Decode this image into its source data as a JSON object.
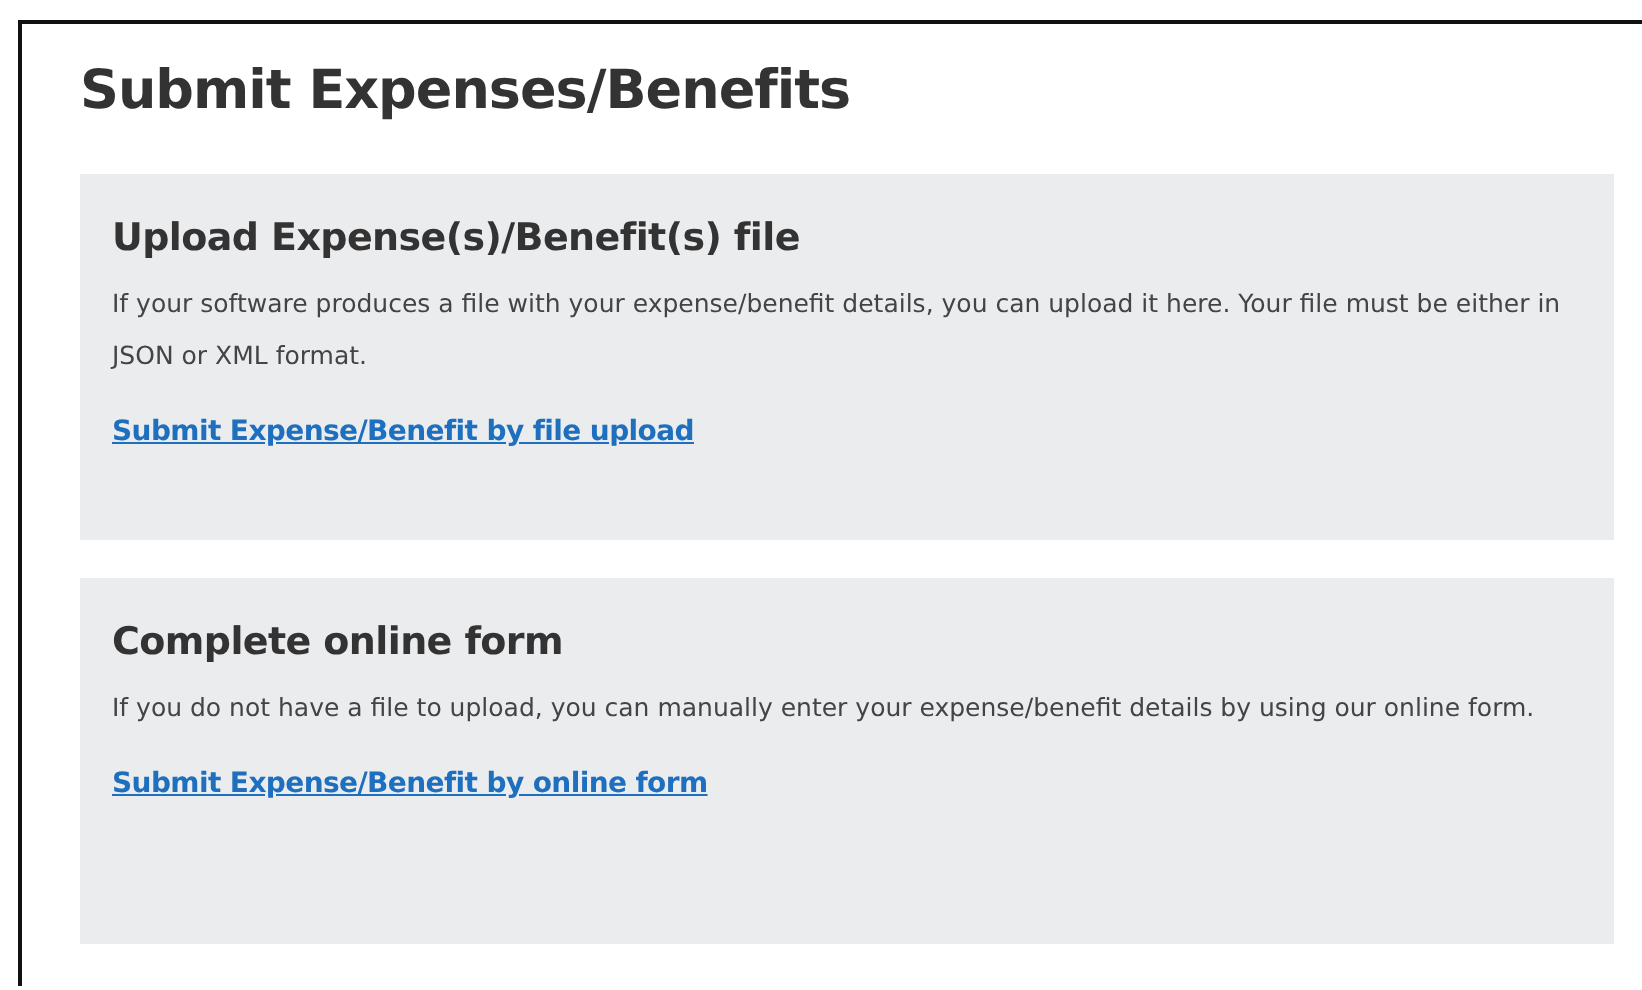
{
  "title": "Submit Expenses/Benefits",
  "sections": [
    {
      "heading": "Upload Expense(s)/Benefit(s) file",
      "text": "If your software produces a file with your expense/benefit details, you can upload it here. Your file must be either in JSON or XML format.",
      "link": "Submit Expense/Benefit by file upload"
    },
    {
      "heading": "Complete online form",
      "text": "If you do not have a file to upload, you can manually enter your expense/benefit details by using our online form.",
      "link": "Submit Expense/Benefit by online form"
    }
  ]
}
